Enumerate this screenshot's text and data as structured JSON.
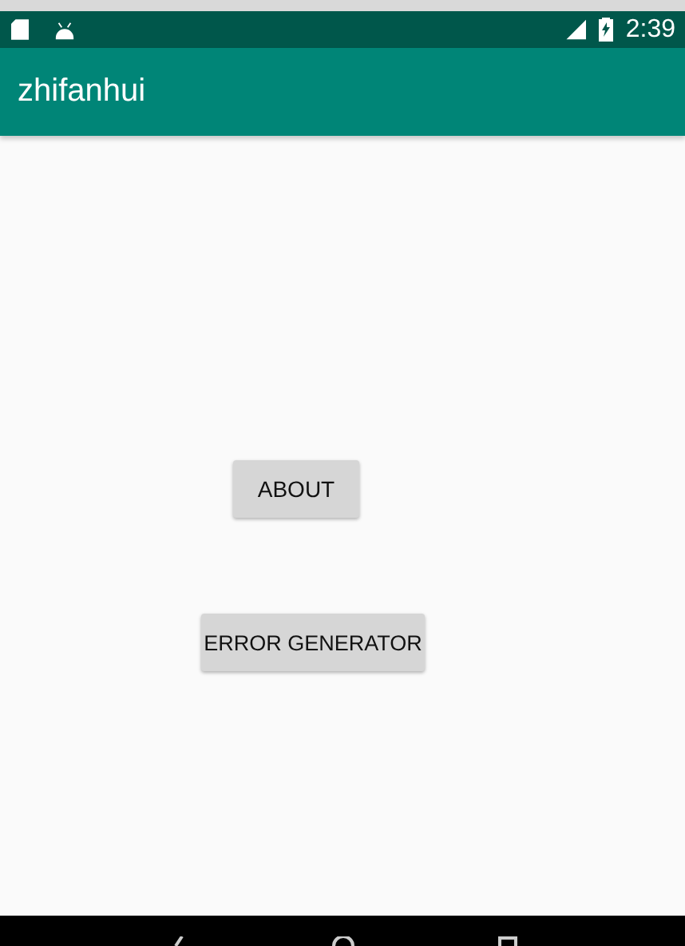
{
  "status_bar": {
    "time": "2:39"
  },
  "app_bar": {
    "title": "zhifanhui"
  },
  "buttons": [
    {
      "label": "ABOUT"
    },
    {
      "label": "ERROR GENERATOR"
    }
  ]
}
